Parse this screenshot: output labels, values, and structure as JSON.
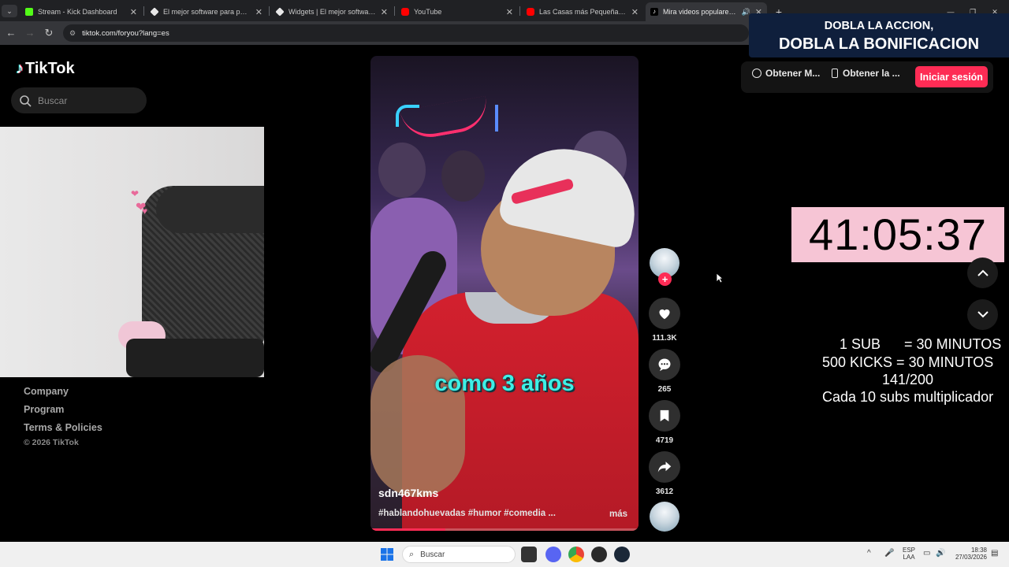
{
  "browser": {
    "tabs": [
      {
        "title": "Stream - Kick Dashboard",
        "active": false,
        "fav_color": "#53fc18"
      },
      {
        "title": "El mejor software para potencia",
        "active": false,
        "fav_color": "#e8e8e8"
      },
      {
        "title": "Widgets | El mejor software pa",
        "active": false,
        "fav_color": "#e8e8e8"
      },
      {
        "title": "YouTube",
        "active": false,
        "fav_color": "#ff0000"
      },
      {
        "title": "Las Casas más Pequeñas del M",
        "active": false,
        "fav_color": "#ff0000"
      },
      {
        "title": "Mira videos populares sele",
        "active": true,
        "fav_color": "#ffffff"
      }
    ],
    "url": "tiktok.com/foryou?lang=es"
  },
  "tiktok": {
    "logo_text": "TikTok",
    "search_placeholder": "Buscar",
    "footer": {
      "links": [
        "Company",
        "Program",
        "Terms & Policies"
      ],
      "copyright": "© 2026 TikTok"
    },
    "video": {
      "caption": "como 3 años",
      "author": "sdn467kms",
      "description": "#hablandohuevadas #humor #comedia ...",
      "more": "más",
      "progress": 0.28
    },
    "actions": {
      "likes": "111.3K",
      "comments": "265",
      "saves": "4719",
      "shares": "3612"
    },
    "topbar": {
      "btn1": "Obtener M...",
      "btn2": "Obtener la ...",
      "login": "Iniciar sesión"
    }
  },
  "overlay": {
    "promo_line1": "DOBLA LA ACCION,",
    "promo_line2": "DOBLA LA BONIFICACION",
    "timer": "41:05:37",
    "rules": [
      "1 SUB      = 30 MINUTOS",
      "500 KICKS = 30 MINUTOS",
      "141/200",
      "Cada 10 subs multiplicador"
    ]
  },
  "taskbar": {
    "search_placeholder": "Buscar",
    "lang_top": "ESP",
    "lang_bottom": "LAA",
    "time": "18:38",
    "date": "27/03/2026"
  },
  "colors": {
    "accent": "#fe2c55",
    "caption": "#3ef0e6",
    "timer_bg": "#f6c5d5"
  }
}
